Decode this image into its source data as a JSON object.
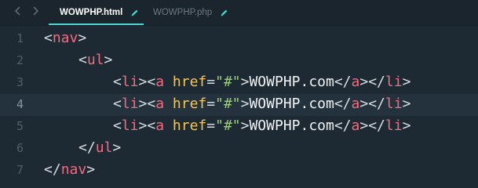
{
  "tabs": [
    {
      "label": "WOWPHP.html",
      "active": true
    },
    {
      "label": "WOWPHP.php",
      "active": false
    }
  ],
  "gutter": {
    "line_numbers": [
      "1",
      "2",
      "3",
      "4",
      "5",
      "6",
      "7"
    ],
    "current_line": "4"
  },
  "code": {
    "l1": {
      "open": "<",
      "tag": "nav",
      "close": ">"
    },
    "l2": {
      "open": "<",
      "tag": "ul",
      "close": ">"
    },
    "item": {
      "li_open": "<",
      "li_tag": "li",
      "li_gt": ">",
      "a_open": "<",
      "a_tag": "a",
      "space": " ",
      "attr": "href",
      "eq": "=",
      "value": "\"#\"",
      "a_gt": ">",
      "text": "WOWPHP.com",
      "a_close_open": "</",
      "a_close_tag": "a",
      "a_close_gt": ">",
      "li_close_open": "</",
      "li_close_tag": "li",
      "li_close_gt": ">"
    },
    "l6": {
      "open": "</",
      "tag": "ul",
      "close": ">"
    },
    "l7": {
      "open": "</",
      "tag": "nav",
      "close": ">"
    }
  },
  "colors": {
    "background": "#1e2a33",
    "tag": "#f36b7f",
    "attribute": "#f4c55a",
    "string": "#98d36b",
    "accent": "#4fd6d2"
  },
  "icons": [
    "chevron-left-icon",
    "chevron-right-icon",
    "pencil-icon"
  ]
}
